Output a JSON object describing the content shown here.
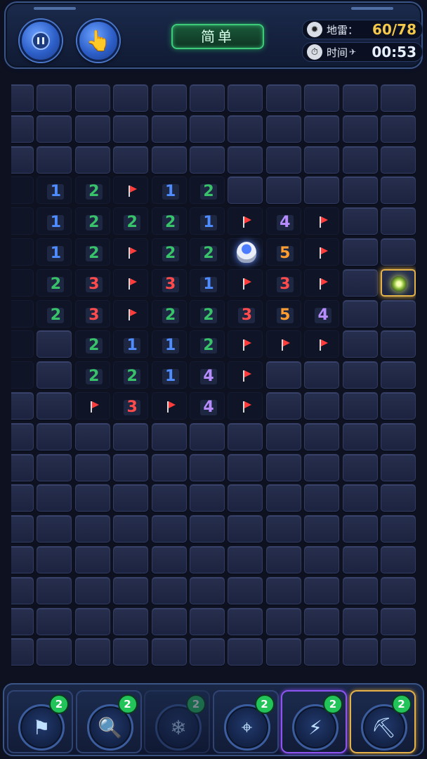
{
  "hud": {
    "difficulty": "简单",
    "mines_label": "地雷",
    "mines_value": "60/78",
    "time_label": "时间",
    "time_value": "00:53"
  },
  "board": {
    "rows": [
      [
        "",
        "",
        "",
        "",
        "",
        "",
        "",
        "",
        "",
        "",
        ""
      ],
      [
        "",
        "",
        "",
        "",
        "",
        "",
        "",
        "",
        "",
        "",
        ""
      ],
      [
        "",
        "",
        "",
        "",
        "",
        "",
        "",
        "",
        "",
        "",
        ""
      ],
      [
        "o",
        "o1",
        "o2",
        "F",
        "o1",
        "o2",
        "",
        "",
        "",
        "",
        ""
      ],
      [
        "o",
        "o1",
        "o2",
        "o2",
        "o2",
        "o1",
        "F",
        "o4",
        "F",
        "",
        ""
      ],
      [
        "o",
        "o1",
        "o2",
        "F",
        "o2",
        "o2",
        "A",
        "o5",
        "F",
        "",
        ""
      ],
      [
        "o",
        "o2",
        "o3",
        "F",
        "o3",
        "o1",
        "F",
        "o3",
        "F",
        "",
        "G"
      ],
      [
        "o",
        "o2",
        "o3",
        "F",
        "o2",
        "o2",
        "o3",
        "o5",
        "o4",
        "",
        ""
      ],
      [
        "o",
        "",
        "o2",
        "o1",
        "o1",
        "o2",
        "F",
        "F",
        "F",
        "",
        ""
      ],
      [
        "o",
        "",
        "o2",
        "o2",
        "o1",
        "o4",
        "F",
        "",
        "",
        "",
        ""
      ],
      [
        "",
        "",
        "F",
        "o3",
        "F",
        "o4",
        "F",
        "",
        "",
        "",
        ""
      ],
      [
        "",
        "",
        "",
        "",
        "",
        "",
        "",
        "",
        "",
        "",
        ""
      ],
      [
        "",
        "",
        "",
        "",
        "",
        "",
        "",
        "",
        "",
        "",
        ""
      ],
      [
        "",
        "",
        "",
        "",
        "",
        "",
        "",
        "",
        "",
        "",
        ""
      ],
      [
        "",
        "",
        "",
        "",
        "",
        "",
        "",
        "",
        "",
        "",
        ""
      ],
      [
        "",
        "",
        "",
        "",
        "",
        "",
        "",
        "",
        "",
        "",
        ""
      ],
      [
        "",
        "",
        "",
        "",
        "",
        "",
        "",
        "",
        "",
        "",
        ""
      ],
      [
        "",
        "",
        "",
        "",
        "",
        "",
        "",
        "",
        "",
        "",
        ""
      ],
      [
        "",
        "",
        "",
        "",
        "",
        "",
        "",
        "",
        "",
        "",
        ""
      ]
    ]
  },
  "tools": [
    {
      "icon": "flag-icon",
      "glyph": "⚑",
      "count": "2",
      "state": "normal"
    },
    {
      "icon": "magnifier-icon",
      "glyph": "🔍",
      "count": "2",
      "state": "normal"
    },
    {
      "icon": "snowflake-icon",
      "glyph": "❄",
      "count": "2",
      "state": "disabled"
    },
    {
      "icon": "target-icon",
      "glyph": "⌖",
      "count": "2",
      "state": "normal"
    },
    {
      "icon": "lightning-icon",
      "glyph": "⚡",
      "count": "2",
      "state": "purple"
    },
    {
      "icon": "shovel-icon",
      "glyph": "⛏",
      "count": "2",
      "state": "gold"
    }
  ]
}
